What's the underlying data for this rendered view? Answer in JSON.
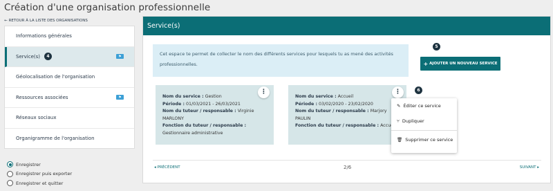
{
  "page": {
    "title": "Création d'une organisation professionnelle"
  },
  "back_link": {
    "arrow": "←",
    "label": "RETOUR À LA LISTE DES ORGANISATIONS"
  },
  "sidebar": {
    "items": [
      {
        "label": "Informations générales"
      },
      {
        "label": "Service(s)",
        "step": "4",
        "flag": "⚑"
      },
      {
        "label": "Géolocalisation de l'organisation"
      },
      {
        "label": "Ressources associées",
        "flag": "⚑"
      },
      {
        "label": "Réseaux sociaux"
      },
      {
        "label": "Organigramme de l'organisation"
      }
    ]
  },
  "save_options": [
    {
      "label": "Enregistrer",
      "checked": true
    },
    {
      "label": "Enregistrer puis exporter",
      "checked": false
    },
    {
      "label": "Enregistrer et quitter",
      "checked": false
    }
  ],
  "panel": {
    "header": "Service(s)",
    "info_text": "Cet espace te permet de collecter le nom des différents services pour lesquels tu as mené des activités professionnelles.",
    "add_button": {
      "icon": "+",
      "label": "AJOUTER UN NOUVEAU SERVICE"
    },
    "step5": "5",
    "step6": "6",
    "kebab_glyph": "⋮",
    "cards": [
      {
        "service_label": "Nom du service :",
        "service": "Gestion",
        "periode_label": "Période :",
        "periode": "01/03/2021 - 26/03/2021",
        "tuteur_label": "Nom du tuteur / responsable :",
        "tuteur": "Virginie MARLONY",
        "fonction_label": "Fonction du tuteur / responsable :",
        "fonction": "Gestionnaire administrative"
      },
      {
        "service_label": "Nom du service :",
        "service": "Accueil",
        "periode_label": "Période :",
        "periode": "03/02/2020 - 23/02/2020",
        "tuteur_label": "Nom du tuteur / responsable :",
        "tuteur": "Marjory PAULIN",
        "fonction_label": "Fonction du tuteur / responsable :",
        "fonction": "Accueil"
      }
    ],
    "menu": {
      "items": [
        {
          "icon": "✎",
          "label": "Éditer ce service"
        },
        {
          "icon": "⑂",
          "label": "Dupliquer"
        },
        {
          "icon": "🗑",
          "label": "Supprimer ce service"
        }
      ]
    },
    "pagination": {
      "prev": "◂ PRÉCÉDENT",
      "page": "2/6",
      "next": "SUIVANT ▸"
    }
  },
  "colors": {
    "accent": "#0b6e76",
    "info_bg": "#dbeef6",
    "card_bg": "#d6e6e8",
    "badge": "#1e3340"
  }
}
